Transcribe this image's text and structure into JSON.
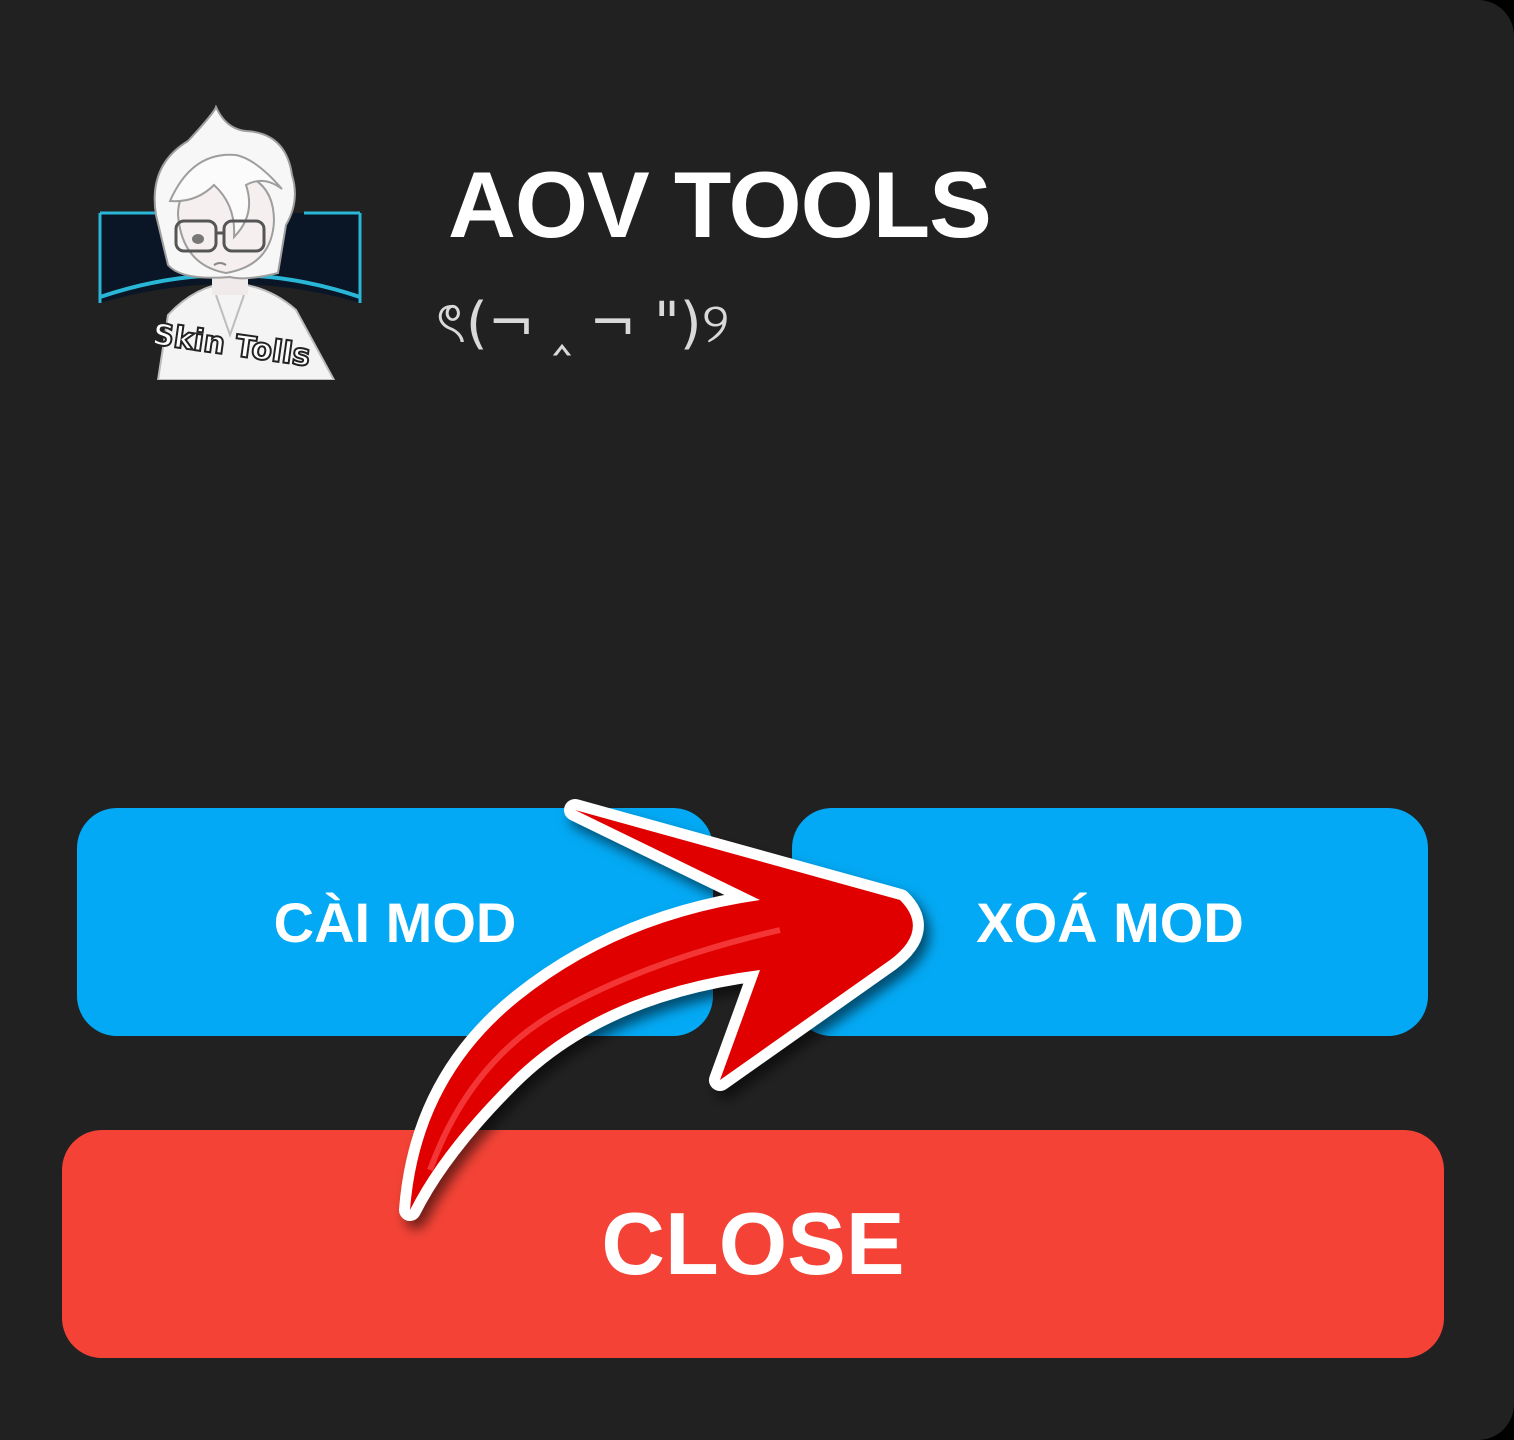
{
  "app": {
    "title": "AOV TOOLS",
    "subtitle": "ৎ(¬ ‸ ¬ \")୨",
    "logo_text": "Skin Tolls"
  },
  "buttons": {
    "install_label": "CÀI MOD",
    "remove_label": "XOÁ MOD",
    "close_label": "CLOSE"
  },
  "colors": {
    "dialog_background": "#212121",
    "install_button": "#03a9f4",
    "remove_button": "#03a9f4",
    "close_button": "#f44336",
    "annotation_arrow": "#e00000"
  },
  "icons": {
    "annotation": "red-arrow-icon"
  }
}
